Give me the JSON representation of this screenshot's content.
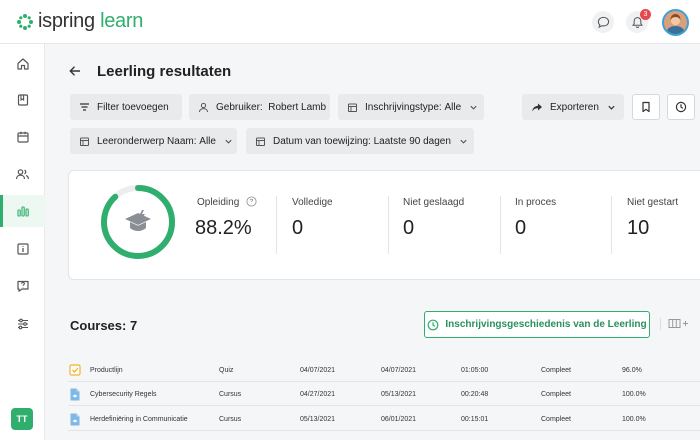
{
  "app": {
    "logo_text_left": "ispring",
    "logo_text_right": "learn",
    "notification_count": "3",
    "user_initials": "TT",
    "brand_color": "#2fae6e"
  },
  "sidebar": {
    "items": [
      {
        "name": "home-icon"
      },
      {
        "name": "book-icon"
      },
      {
        "name": "calendar-icon"
      },
      {
        "name": "users-icon"
      },
      {
        "name": "bar-chart-icon",
        "active": true
      },
      {
        "name": "info-icon"
      },
      {
        "name": "help-icon"
      },
      {
        "name": "sliders-icon"
      }
    ]
  },
  "page": {
    "title": "Leerling resultaten"
  },
  "filters": {
    "add_filter": "Filter toevoegen",
    "user_label": "Gebruiker:",
    "user_value": "Robert Lamb",
    "enroll_label": "Inschrijvingstype:",
    "enroll_value": "Alle",
    "export": "Exporteren",
    "subject_label": "Leeronderwerp Naam:",
    "subject_value": "Alle",
    "date_label": "Datum van toewijzing:",
    "date_value": "Laatste 90 dagen"
  },
  "stats": {
    "training_label": "Opleiding",
    "training_value": "88.2%",
    "progress_fraction": 0.882,
    "completed_label": "Volledige",
    "completed_value": "0",
    "failed_label": "Niet geslaagd",
    "failed_value": "0",
    "in_progress_label": "In proces",
    "in_progress_value": "0",
    "not_started_label": "Niet gestart",
    "not_started_value": "10"
  },
  "courses": {
    "title": "Courses: 7",
    "history_button": "Inschrijvingsgeschiedenis van de Leerling",
    "rows": [
      {
        "name": "Productlijn",
        "type": "Quiz",
        "assigned": "04/07/2021",
        "due": "04/07/2021",
        "time": "01:05:00",
        "status": "Compleet",
        "score": "96.0%",
        "icon": "quiz-icon"
      },
      {
        "name": "Cybersecurity Regels",
        "type": "Cursus",
        "assigned": "04/27/2021",
        "due": "05/13/2021",
        "time": "00:20:48",
        "status": "Compleet",
        "score": "100.0%",
        "icon": "course-icon"
      },
      {
        "name": "Herdefiniëring in Communicatie",
        "type": "Cursus",
        "assigned": "05/13/2021",
        "due": "06/01/2021",
        "time": "00:15:01",
        "status": "Compleet",
        "score": "100.0%",
        "icon": "course-icon"
      }
    ]
  }
}
